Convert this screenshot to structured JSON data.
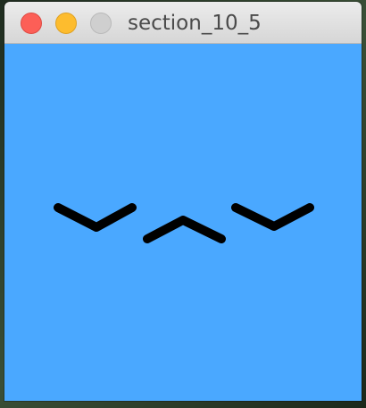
{
  "window": {
    "title": "section_10_5"
  },
  "canvas": {
    "background_color": "#4aa8ff",
    "stroke_color": "#000000",
    "shapes": [
      "left-eye-check",
      "mouth-caret",
      "right-eye-check"
    ]
  }
}
